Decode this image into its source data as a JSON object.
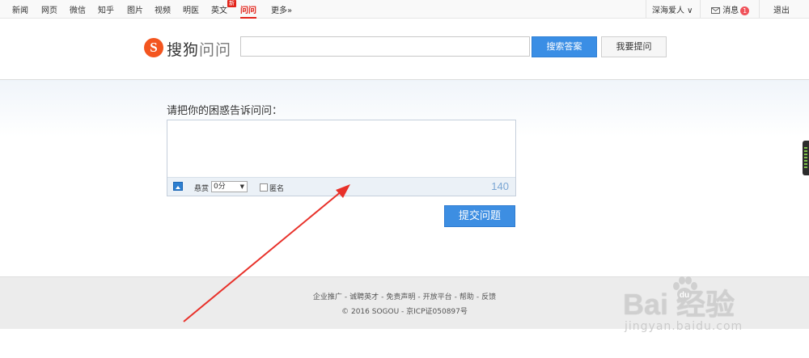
{
  "topnav": {
    "items": [
      {
        "label": "新闻"
      },
      {
        "label": "网页"
      },
      {
        "label": "微信"
      },
      {
        "label": "知乎"
      },
      {
        "label": "图片"
      },
      {
        "label": "视频"
      },
      {
        "label": "明医"
      },
      {
        "label": "英文"
      },
      {
        "label": "问问"
      },
      {
        "label": "更多»"
      }
    ],
    "new_badge": "新",
    "user": "深海爱人 ∨",
    "messages_label": "消息",
    "messages_count": "1",
    "logout": "退出"
  },
  "header": {
    "logo_letter": "S",
    "logo_text_brand": "搜狗",
    "logo_text_product": "问问",
    "search_value": "",
    "search_button": "搜索答案",
    "ask_button": "我要提问"
  },
  "main": {
    "prompt": "请把你的困惑告诉问问：",
    "question_value": "",
    "reward_label": "悬赏",
    "reward_value": "0分",
    "anonymous_label": "匿名",
    "char_count": "140",
    "submit_button": "提交问题"
  },
  "footer": {
    "links": [
      {
        "label": "企业推广"
      },
      {
        "label": "诚聘英才"
      },
      {
        "label": "免责声明"
      },
      {
        "label": "开放平台"
      },
      {
        "label": "帮助"
      },
      {
        "label": "反馈"
      }
    ],
    "separator": "-",
    "copyright": "© 2016 SOGOU - 京ICP证050897号"
  },
  "watermark": {
    "brand": "Bai  经验",
    "url": "jingyan.baidu.com"
  },
  "colors": {
    "accent_red": "#e2231a",
    "button_blue": "#3a8ee5",
    "logo_orange": "#f3551f",
    "arrow_red": "#e8312a"
  }
}
